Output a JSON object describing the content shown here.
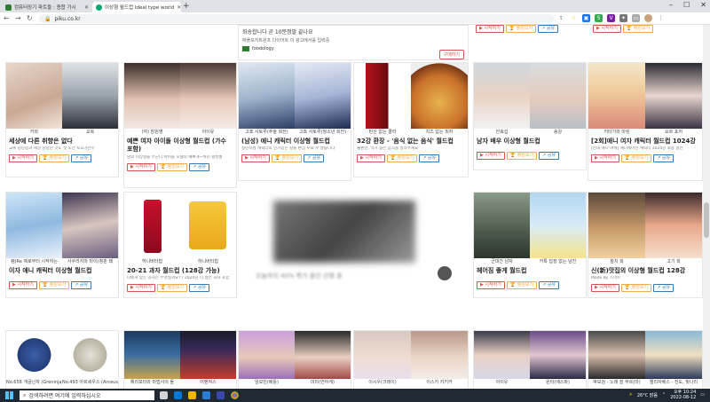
{
  "tabs": [
    {
      "label": "컴퓨터장기 파트들 : 종합 가시",
      "active": false,
      "color": "#2e7d32"
    },
    {
      "label": "이상형 월드컵 Ideal type world",
      "active": true,
      "color": "#00a86b"
    }
  ],
  "address": {
    "url": "piku.co.kr"
  },
  "ad_top": {
    "line1": "죄송합니다 곧 10분정말 끝나요",
    "line2": "애플포지트윈프 다이어트 이 광고에서를 입력중",
    "brand": "foodology",
    "button": "구매하기"
  },
  "buttons": {
    "start": "▶ 시작하기",
    "ranking": "🏆 랭킹보기",
    "share": "↗ 공유"
  },
  "cards": [
    {
      "caps": [
        "카와",
        "교복"
      ],
      "title": "세상에 다른 취향은 없다",
      "desc": "교복 당당함과 세상 당당한 것도 첫 도전 토요가은부"
    },
    {
      "caps": [
        "(여) 장원영",
        "아이유"
      ],
      "title": "예쁜 여자 아이돌 이상형 월드컵 (가수 포함)",
      "desc": "남의 이상형을 부군다 아이돌 모델의 예쁘게~위진 랭킹월"
    },
    {
      "caps": [
        "고죠 사토루(주술 회전)",
        "고죠 사토루(청소년 회전)"
      ],
      "title": "(남성) 애니 캐릭터 이상형 월드컵",
      "desc": "청년시절 캐릭터의 인기있는 정들 편집 투표 수 많습니다"
    },
    {
      "caps": [
        "탄산 없는 콜라",
        "치즈 없는 피자"
      ],
      "title": "32강 환장 - '음식 없는 음식' 월드컵",
      "desc": "불편한, 먹기 싫은 음식을 골라주세요"
    },
    {
      "caps": [
        "안효섭",
        "송강"
      ],
      "title": "남자 배우 이상형 월드컵",
      "desc": ""
    },
    {
      "caps": [
        "키타가와 마린",
        "요르 포저"
      ],
      "title": "[2회]애니 여자 캐릭터 월드컵 1024강",
      "desc": "[인대 애니 여캐] 애니메이션 캐릭터 1024강 최종 결선"
    },
    {
      "caps": [
        "렘(Re 제로부터 시작하는",
        "사쿠라지마 마이(청춘 돼"
      ],
      "title": "이자 애니 캐릭터 이상형 월드컵",
      "desc": ""
    },
    {
      "caps": [
        "허니버터칩",
        "하니버터칩"
      ],
      "title": "20-21 과자 월드컵 (128강 가능)",
      "desc": "나에게 맞는 과자는 무엇일까요? / 2020년 더 많은 과자 포함"
    },
    {
      "caps": [
        "군대간 남자",
        "카톡 답장 없는 남친"
      ],
      "title": "헤어짐 좋게 월드컵",
      "desc": ""
    },
    {
      "caps": [
        "참치 회",
        "고기 회"
      ],
      "title": "신(新)맛집의 이상형 월드컵 128강",
      "desc": "Made By 스미트"
    },
    {
      "caps": [
        "No.658 개굴닌자 (Greninja)",
        "No.493 아르세우스 (Arceus)"
      ],
      "title": "",
      "desc": ""
    },
    {
      "caps": [
        "해리포터와 마법사의 돌",
        "어벤져스"
      ],
      "title": "",
      "desc": ""
    },
    {
      "caps": [
        "임모빈(배틀)",
        "미미(연하게)"
      ],
      "title": "",
      "desc": ""
    },
    {
      "caps": [
        "이시우(크레이)",
        "이스키 키키카"
      ],
      "title": "",
      "desc": ""
    },
    {
      "caps": [
        "아이유",
        "윈터(에스파)"
      ],
      "title": "",
      "desc": ""
    },
    {
      "caps": [
        "박보검 - 노래 잘 부르(마)",
        "엘리자베스 - 전도, 빛나리"
      ],
      "title": "",
      "desc": ""
    }
  ],
  "ad_mid": {
    "line1": "오늘까지 40% 특가 들인 산행 중"
  },
  "taskbar": {
    "search_placeholder": "검색하려면 여기에 입력하십시오",
    "weather": "26°C 맑음",
    "time": "오후 10:24",
    "date": "2022-08-12"
  }
}
